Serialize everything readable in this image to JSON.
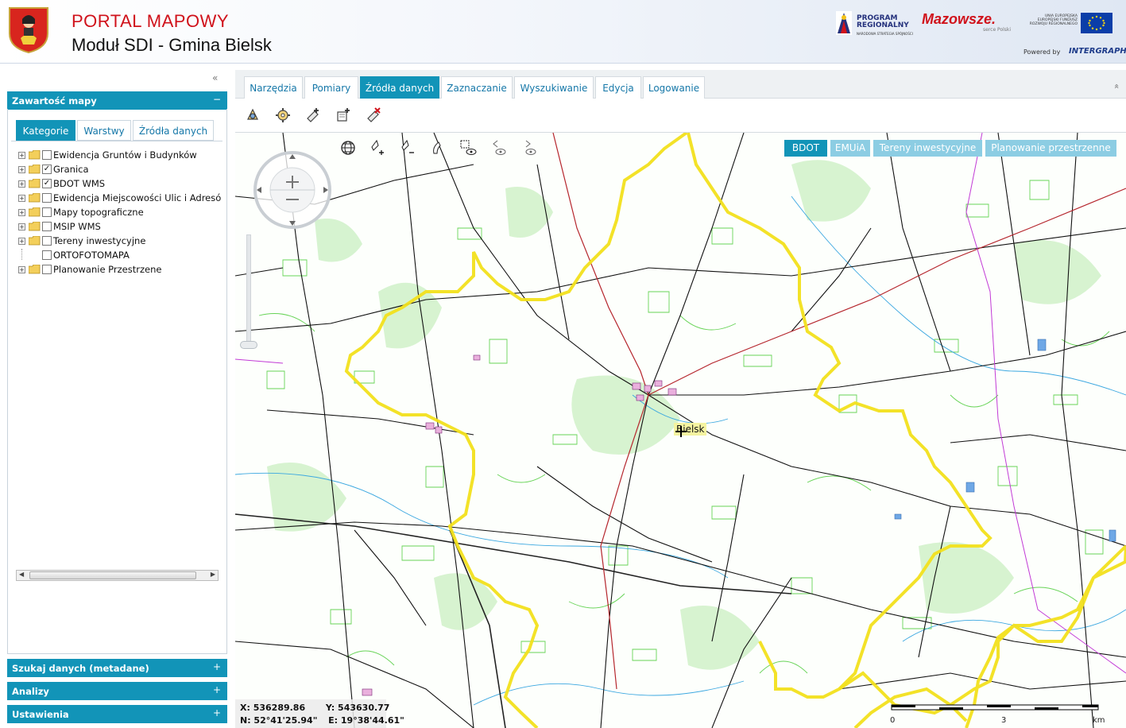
{
  "header": {
    "portal_title": "PORTAL MAPOWY",
    "module_title": "Moduł SDI - Gmina Bielsk",
    "program_logo": "PROGRAM\nREGIONALNY",
    "program_sub": "NARODOWA STRATEGIA SPÓJNOŚCI",
    "mazowsze_logo": "Mazowsze.",
    "mazowsze_sub": "serce Polski",
    "eu_text": "UNIA EUROPEJSKA EUROPEJSKI FUNDUSZ ROZWOJU REGIONALNEGO",
    "powered_by": "Powered by",
    "intergraph": "INTERGRAPH"
  },
  "left_panel": {
    "collapse_icon": "«",
    "contents_title": "Zawartość mapy",
    "contents_symbol": "−",
    "subtabs": [
      {
        "label": "Kategorie",
        "active": true
      },
      {
        "label": "Warstwy",
        "active": false
      },
      {
        "label": "Źródła danych",
        "active": false
      }
    ],
    "tree": [
      {
        "label": "Ewidencja Gruntów i Budynków",
        "checked": false,
        "expandable": true
      },
      {
        "label": "Granica",
        "checked": true,
        "expandable": true
      },
      {
        "label": "BDOT WMS",
        "checked": true,
        "expandable": true
      },
      {
        "label": "Ewidencja Miejscowości Ulic i Adresó",
        "checked": false,
        "expandable": true
      },
      {
        "label": "Mapy topograficzne",
        "checked": false,
        "expandable": true
      },
      {
        "label": "MSIP WMS",
        "checked": false,
        "expandable": true
      },
      {
        "label": "Tereny inwestycyjne",
        "checked": false,
        "expandable": true
      },
      {
        "label": "ORTOFOTOMAPA",
        "checked": false,
        "expandable": false
      },
      {
        "label": "Planowanie Przestrzene",
        "checked": false,
        "expandable": true
      }
    ],
    "sections": [
      {
        "label": "Szukaj danych (metadane)",
        "symbol": "+"
      },
      {
        "label": "Analizy",
        "symbol": "+"
      },
      {
        "label": "Ustawienia",
        "symbol": "+"
      }
    ]
  },
  "tabs": [
    {
      "label": "Narzędzia",
      "active": false
    },
    {
      "label": "Pomiary",
      "active": false
    },
    {
      "label": "Źródła danych",
      "active": true
    },
    {
      "label": "Zaznaczanie",
      "active": false
    },
    {
      "label": "Wyszukiwanie",
      "active": false
    },
    {
      "label": "Edycja",
      "active": false
    },
    {
      "label": "Logowanie",
      "active": false
    }
  ],
  "collapse_top_icon": "«",
  "toolbar_icons": [
    "add-data-source-icon",
    "wms-settings-icon",
    "add-layer-icon",
    "new-layer-icon",
    "remove-layer-icon"
  ],
  "map": {
    "tool_icons": [
      "globe-icon",
      "zoom-in-tool-icon",
      "zoom-out-tool-icon",
      "pan-icon",
      "zoom-box-icon",
      "previous-view-icon",
      "next-view-icon"
    ],
    "layer_buttons": [
      {
        "label": "BDOT",
        "active": true
      },
      {
        "label": "EMUiA",
        "active": false
      },
      {
        "label": "Tereny inwestycyjne",
        "active": false
      },
      {
        "label": "Planowanie przestrzenne",
        "active": false
      }
    ],
    "place_label": "Bielsk",
    "coords": {
      "x": "X: 536289.86",
      "y": "Y: 543630.77",
      "n": "N: 52°41'25.94\"",
      "e": "E: 19°38'44.61\""
    },
    "scale": {
      "start": "0",
      "mid": "3",
      "unit": "km"
    }
  },
  "colors": {
    "accent": "#1294b8",
    "accent_light": "#8ccde3",
    "title_red": "#d0121b",
    "boundary_yellow": "#f2e01c"
  }
}
